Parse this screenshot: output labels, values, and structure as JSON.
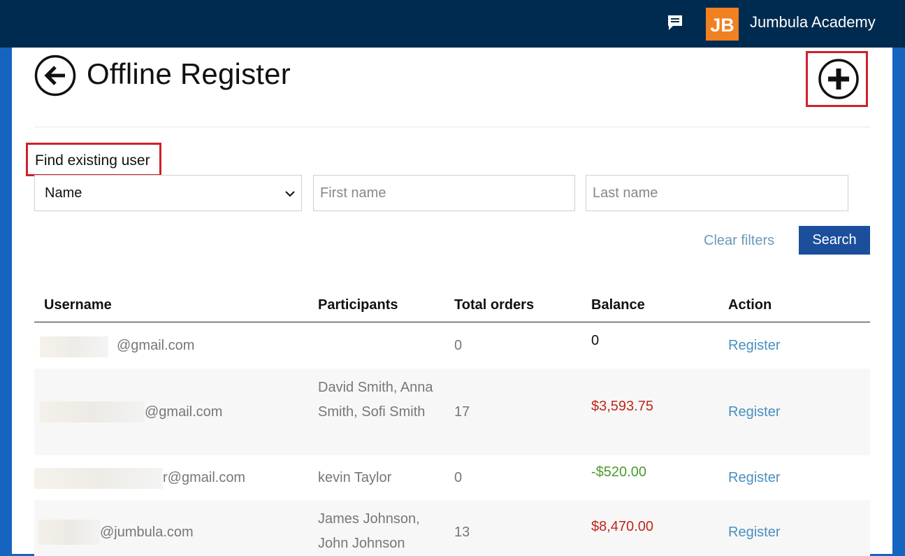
{
  "header": {
    "academy_name": "Jumbula Academy",
    "logo_text": "JB",
    "chat_icon": "chat-icon",
    "colors": {
      "bar": "#002b50",
      "logo": "#f08020",
      "frame": "#1565c0"
    }
  },
  "page": {
    "title": "Offline Register",
    "back_icon": "arrow-left-circle-icon",
    "add_icon": "plus-circle-icon"
  },
  "filters": {
    "find_label": "Find existing user",
    "search_by_selected": "Name",
    "first_name_placeholder": "First name",
    "last_name_placeholder": "Last name",
    "clear_label": "Clear filters",
    "search_label": "Search"
  },
  "table": {
    "columns": [
      "Username",
      "Participants",
      "Total orders",
      "Balance",
      "Action"
    ],
    "rows": [
      {
        "username": "@gmail.com",
        "participants": "",
        "total_orders": "0",
        "balance": "0",
        "action": "Register"
      },
      {
        "username": "@gmail.com",
        "participants": "David Smith, Anna Smith, Sofi Smith",
        "total_orders": "17",
        "balance": "$3,593.75",
        "action": "Register"
      },
      {
        "username": "r@gmail.com",
        "participants": "kevin Taylor",
        "total_orders": "0",
        "balance": "-$520.00",
        "action": "Register"
      },
      {
        "username": "@jumbula.com",
        "participants": "James Johnson, John Johnson",
        "total_orders": "13",
        "balance": "$8,470.00",
        "action": "Register"
      }
    ]
  }
}
